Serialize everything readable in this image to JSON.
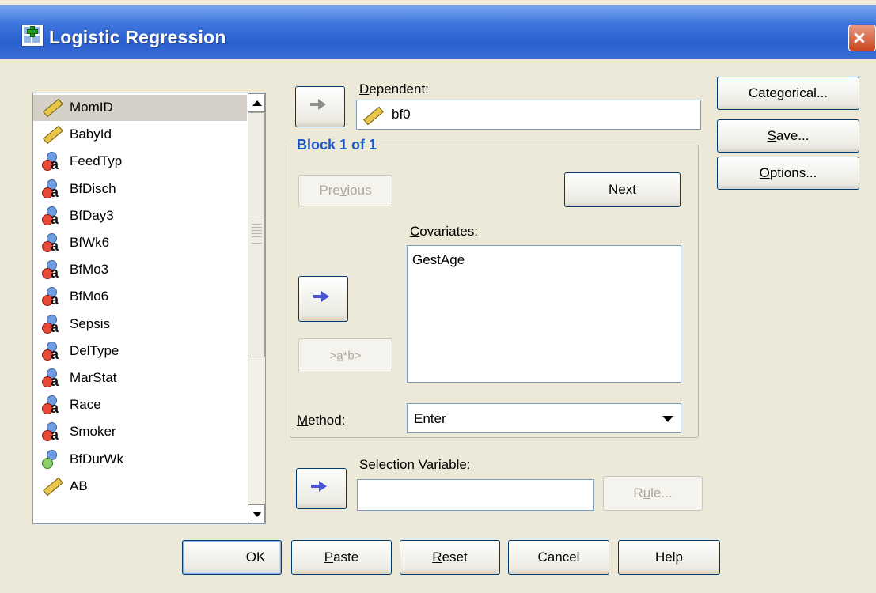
{
  "window": {
    "title": "Logistic Regression",
    "close_glyph": "×"
  },
  "variables": [
    {
      "name": "MomID",
      "icon": "scale-ruler-icon",
      "selected": true
    },
    {
      "name": "BabyId",
      "icon": "scale-ruler-icon"
    },
    {
      "name": "FeedTyp",
      "icon": "nominal-icon"
    },
    {
      "name": "BfDisch",
      "icon": "nominal-icon"
    },
    {
      "name": "BfDay3",
      "icon": "nominal-icon"
    },
    {
      "name": "BfWk6",
      "icon": "nominal-icon"
    },
    {
      "name": "BfMo3",
      "icon": "nominal-icon"
    },
    {
      "name": "BfMo6",
      "icon": "nominal-icon"
    },
    {
      "name": "Sepsis",
      "icon": "nominal-icon"
    },
    {
      "name": "DelType",
      "icon": "nominal-icon"
    },
    {
      "name": "MarStat",
      "icon": "nominal-icon"
    },
    {
      "name": "Race",
      "icon": "nominal-icon"
    },
    {
      "name": "Smoker",
      "icon": "nominal-icon"
    },
    {
      "name": "BfDurWk",
      "icon": "ordinal-icon"
    },
    {
      "name": "AB",
      "icon": "scale-ruler-icon"
    }
  ],
  "dependent": {
    "label": "Dependent:",
    "value": "bf0"
  },
  "block": {
    "legend": "Block 1 of 1",
    "previous": "Previous",
    "next": "Next",
    "covariates_label": "Covariates:",
    "covariates": [
      "GestAge"
    ],
    "interaction": ">a*b>",
    "method_label": "Method:",
    "method_value": "Enter"
  },
  "selection": {
    "label": "Selection Variable:",
    "value": "",
    "rule": "Rule..."
  },
  "side_buttons": {
    "categorical": "Categorical...",
    "save": "Save...",
    "options": "Options..."
  },
  "bottom_buttons": {
    "ok": "OK",
    "paste": "Paste",
    "reset": "Reset",
    "cancel": "Cancel",
    "help": "Help"
  },
  "colors": {
    "title_bar": "#2a5fcf",
    "dialog_bg": "#ece9d8",
    "block_legend": "#1c58c7",
    "arrow": "#4a55d6"
  }
}
